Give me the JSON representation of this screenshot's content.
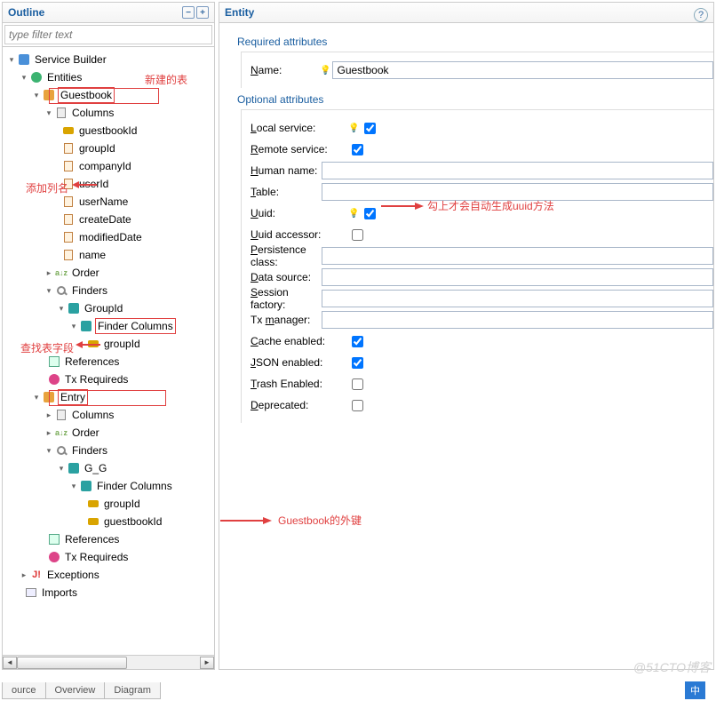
{
  "outline": {
    "title": "Outline",
    "filter_placeholder": "type filter text",
    "tree": {
      "root": "Service Builder",
      "entities": "Entities",
      "guestbook": "Guestbook",
      "columns": "Columns",
      "cols1": [
        "guestbookId",
        "groupId",
        "companyId",
        "userId",
        "userName",
        "createDate",
        "modifiedDate",
        "name"
      ],
      "order": "Order",
      "finders": "Finders",
      "groupid": "GroupId",
      "findercols": "Finder Columns",
      "fcol1": "groupId",
      "references": "References",
      "txreq": "Tx Requireds",
      "entry": "Entry",
      "gg": "G_G",
      "fcol2a": "groupId",
      "fcol2b": "guestbookId",
      "exceptions": "Exceptions",
      "imports": "Imports"
    }
  },
  "annotations": {
    "a1": "新建的表",
    "a2": "添加列名",
    "a3": "查找表字段",
    "a4": "勾上才会自动生成uuid方法",
    "a5": "Guestbook的外键"
  },
  "entity": {
    "title": "Entity",
    "req_section": "Required attributes",
    "opt_section": "Optional attributes",
    "name_label": "Name:",
    "name_value": "Guestbook",
    "local": "Local service:",
    "remote": "Remote service:",
    "human": "Human name:",
    "table": "Table:",
    "uuid": "Uuid:",
    "uuid_acc": "Uuid accessor:",
    "persist": "Persistence class:",
    "datasrc": "Data source:",
    "session": "Session factory:",
    "txm": "Tx manager:",
    "cache": "Cache enabled:",
    "json": "JSON enabled:",
    "trash": "Trash Enabled:",
    "deprecated": "Deprecated:"
  },
  "tabs": {
    "t1": "ource",
    "t2": "Overview",
    "t3": "Diagram"
  },
  "watermark": "@51CTO博客",
  "lang": "中"
}
